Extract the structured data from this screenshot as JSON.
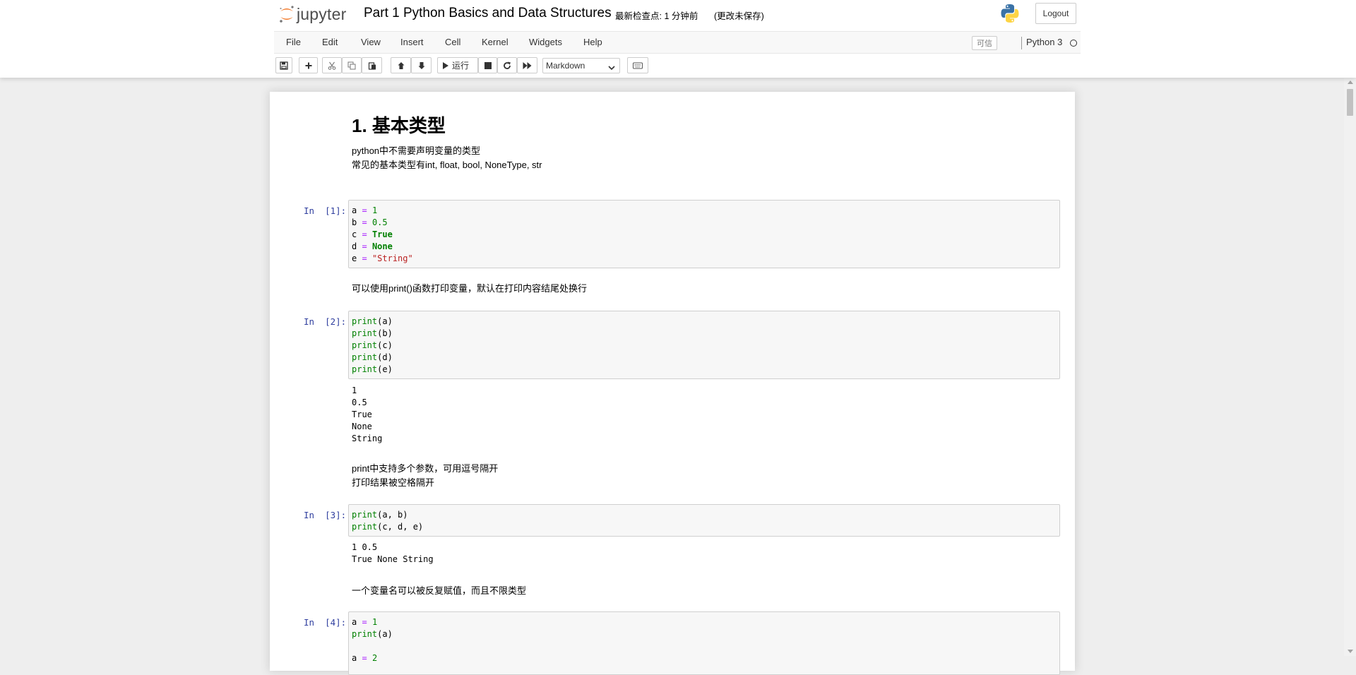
{
  "header": {
    "logo_text": "jupyter",
    "notebook_title": "Part 1 Python Basics and Data Structures",
    "checkpoint": "最新检查点: 1 分钟前",
    "autosave_status": "(更改未保存)",
    "logout_label": "Logout"
  },
  "menubar": {
    "items": [
      "File",
      "Edit",
      "View",
      "Insert",
      "Cell",
      "Kernel",
      "Widgets",
      "Help"
    ],
    "trusted_label": "可信",
    "kernel_name": "Python 3"
  },
  "toolbar": {
    "run_label": "运行",
    "cell_type": "Markdown",
    "icons": [
      "save-icon",
      "plus-icon",
      "cut-icon",
      "copy-icon",
      "paste-icon",
      "arrow-up-icon",
      "arrow-down-icon",
      "play-icon",
      "stop-icon",
      "refresh-icon",
      "fast-forward-icon",
      "keyboard-icon"
    ]
  },
  "colors": {
    "prompt": "#303f9f",
    "keyword": "#008000",
    "operator": "#aa22ff",
    "string": "#ba2121",
    "jupyter_orange": "#f37726"
  },
  "cells": {
    "h1": "1. 基本类型",
    "md1_line1": "python中不需要声明变量的类型",
    "md1_line2": "常见的基本类型有int, float, bool, NoneType, str",
    "in1_prompt": "In  [1]:",
    "in1": {
      "l1": [
        "a",
        " ",
        "=",
        " ",
        "1"
      ],
      "l2": [
        "b",
        " ",
        "=",
        " ",
        "0.5"
      ],
      "l3": [
        "c",
        " ",
        "=",
        " ",
        "True"
      ],
      "l4": [
        "d",
        " ",
        "=",
        " ",
        "None"
      ],
      "l5": [
        "e",
        " ",
        "=",
        " ",
        "\"String\""
      ]
    },
    "md2": "可以使用print()函数打印变量，默认在打印内容结尾处换行",
    "in2_prompt": "In  [2]:",
    "in2": {
      "l1": [
        "print",
        "(a)"
      ],
      "l2": [
        "print",
        "(b)"
      ],
      "l3": [
        "print",
        "(c)"
      ],
      "l4": [
        "print",
        "(d)"
      ],
      "l5": [
        "print",
        "(e)"
      ]
    },
    "out2": [
      "1",
      "0.5",
      "True",
      "None",
      "String"
    ],
    "md3_line1": "print中支持多个参数，可用逗号隔开",
    "md3_line2": "打印结果被空格隔开",
    "in3_prompt": "In  [3]:",
    "in3": {
      "l1": [
        "print",
        "(a, b)"
      ],
      "l2": [
        "print",
        "(c, d, e)"
      ]
    },
    "out3": [
      "1 0.5",
      "True None String"
    ],
    "md4": "一个变量名可以被反复赋值，而且不限类型",
    "in4_prompt": "In  [4]:",
    "in4": {
      "l1": [
        "a",
        " ",
        "=",
        " ",
        "1"
      ],
      "l2": [
        "print",
        "(a)"
      ],
      "l3": [
        "a",
        " ",
        "=",
        " ",
        "2"
      ]
    }
  }
}
